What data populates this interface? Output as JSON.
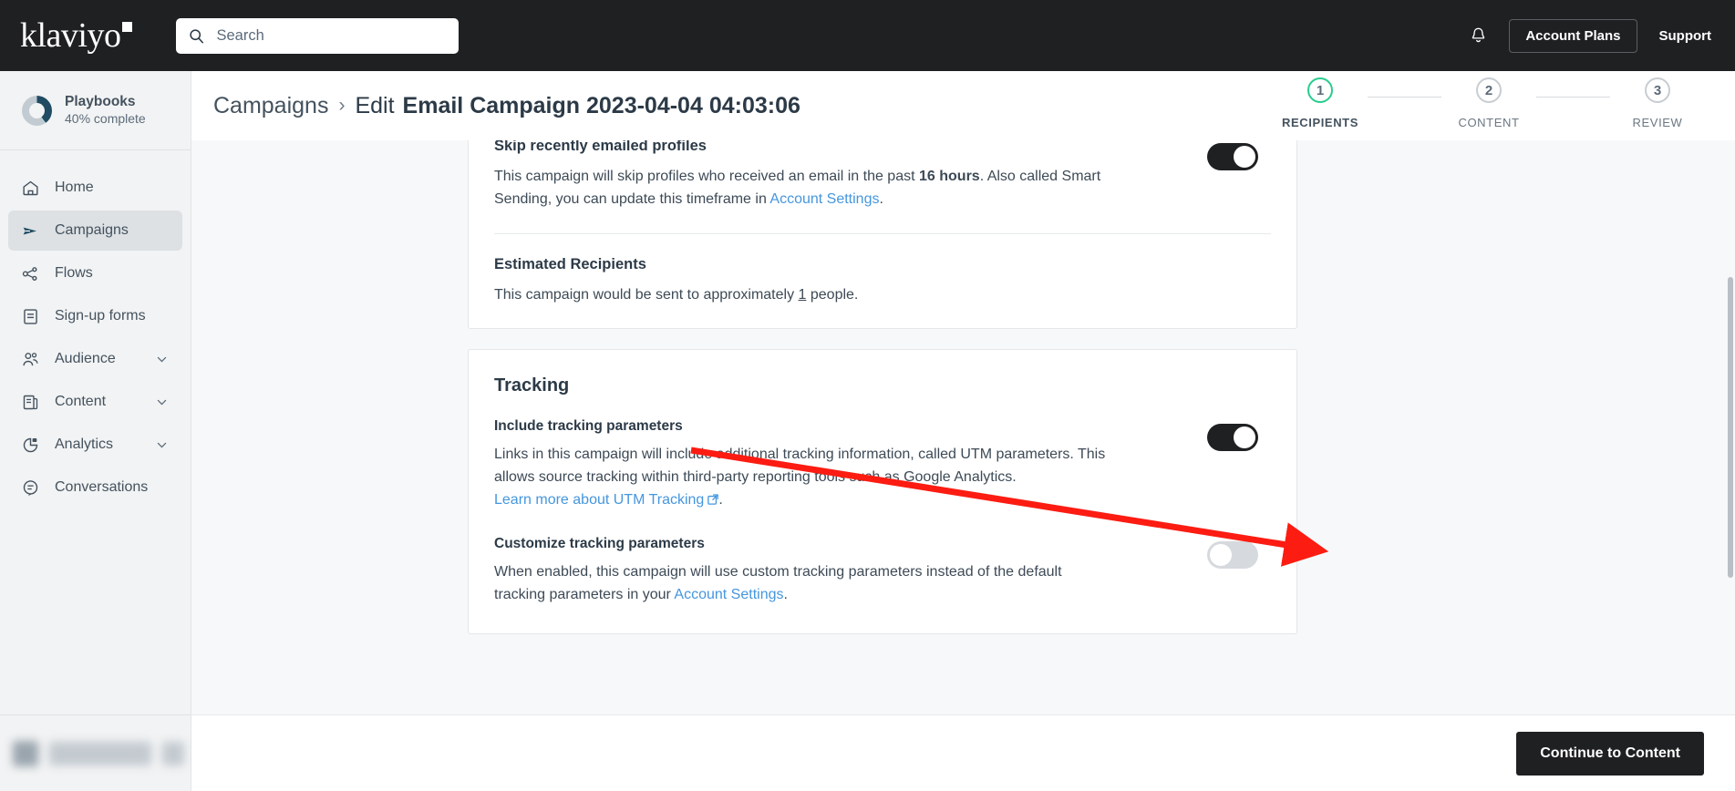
{
  "topbar": {
    "logo_text": "klaviyo",
    "search_placeholder": "Search",
    "search_value": "",
    "search_icon": "search-icon",
    "bell_icon": "bell-icon",
    "account_plans_label": "Account Plans",
    "support_label": "Support"
  },
  "sidebar": {
    "playbooks": {
      "title": "Playbooks",
      "subtitle": "40% complete",
      "progress_percent": 40
    },
    "items": [
      {
        "label": "Home",
        "icon": "home-icon",
        "active": false,
        "expandable": false
      },
      {
        "label": "Campaigns",
        "icon": "paper-plane-icon",
        "active": true,
        "expandable": false
      },
      {
        "label": "Flows",
        "icon": "flows-icon",
        "active": false,
        "expandable": false
      },
      {
        "label": "Sign-up forms",
        "icon": "form-icon",
        "active": false,
        "expandable": false
      },
      {
        "label": "Audience",
        "icon": "people-icon",
        "active": false,
        "expandable": true
      },
      {
        "label": "Content",
        "icon": "content-icon",
        "active": false,
        "expandable": true
      },
      {
        "label": "Analytics",
        "icon": "pie-chart-icon",
        "active": false,
        "expandable": true
      },
      {
        "label": "Conversations",
        "icon": "chat-bubble-icon",
        "active": false,
        "expandable": false
      }
    ]
  },
  "header": {
    "breadcrumb_root": "Campaigns",
    "breadcrumb_separator": "›",
    "edit_prefix": "Edit",
    "campaign_title": "Email Campaign 2023-04-04 04:03:06"
  },
  "stepper": {
    "steps": [
      {
        "number": "1",
        "label": "RECIPIENTS",
        "current": true
      },
      {
        "number": "2",
        "label": "CONTENT",
        "current": false
      },
      {
        "number": "3",
        "label": "REVIEW",
        "current": false
      }
    ],
    "active_color": "#29cc8f",
    "inactive_color": "#c8cdd2"
  },
  "recipients_card": {
    "skip_recent": {
      "heading": "Skip recently emailed profiles",
      "body_part1": "This campaign will skip profiles who received an email in the past ",
      "body_bold": "16 hours",
      "body_part2": ". Also called Smart Sending, you can update this timeframe in ",
      "link_label": "Account Settings",
      "body_part3": ".",
      "toggle_state": "on"
    },
    "estimated": {
      "heading": "Estimated Recipients",
      "body_part1": "This campaign would be sent to approximately ",
      "count": "1",
      "body_part2": " people."
    }
  },
  "tracking_card": {
    "title": "Tracking",
    "include": {
      "heading": "Include tracking parameters",
      "body": "Links in this campaign will include additional tracking information, called UTM parameters. This allows source tracking within third-party reporting tools such as Google Analytics.",
      "link_label": "Learn more about UTM Tracking",
      "link_icon": "external-link-icon",
      "trailing": ".",
      "toggle_state": "on"
    },
    "customize": {
      "heading": "Customize tracking parameters",
      "body_part1": "When enabled, this campaign will use custom tracking parameters instead of the default tracking parameters in your ",
      "link_label": "Account Settings",
      "body_part2": ".",
      "toggle_state": "off"
    }
  },
  "annotation": {
    "type": "arrow",
    "color": "#fc1c12",
    "from_label": "Tracking",
    "to_label": "include-tracking-toggle"
  },
  "footer": {
    "continue_label": "Continue to Content"
  }
}
